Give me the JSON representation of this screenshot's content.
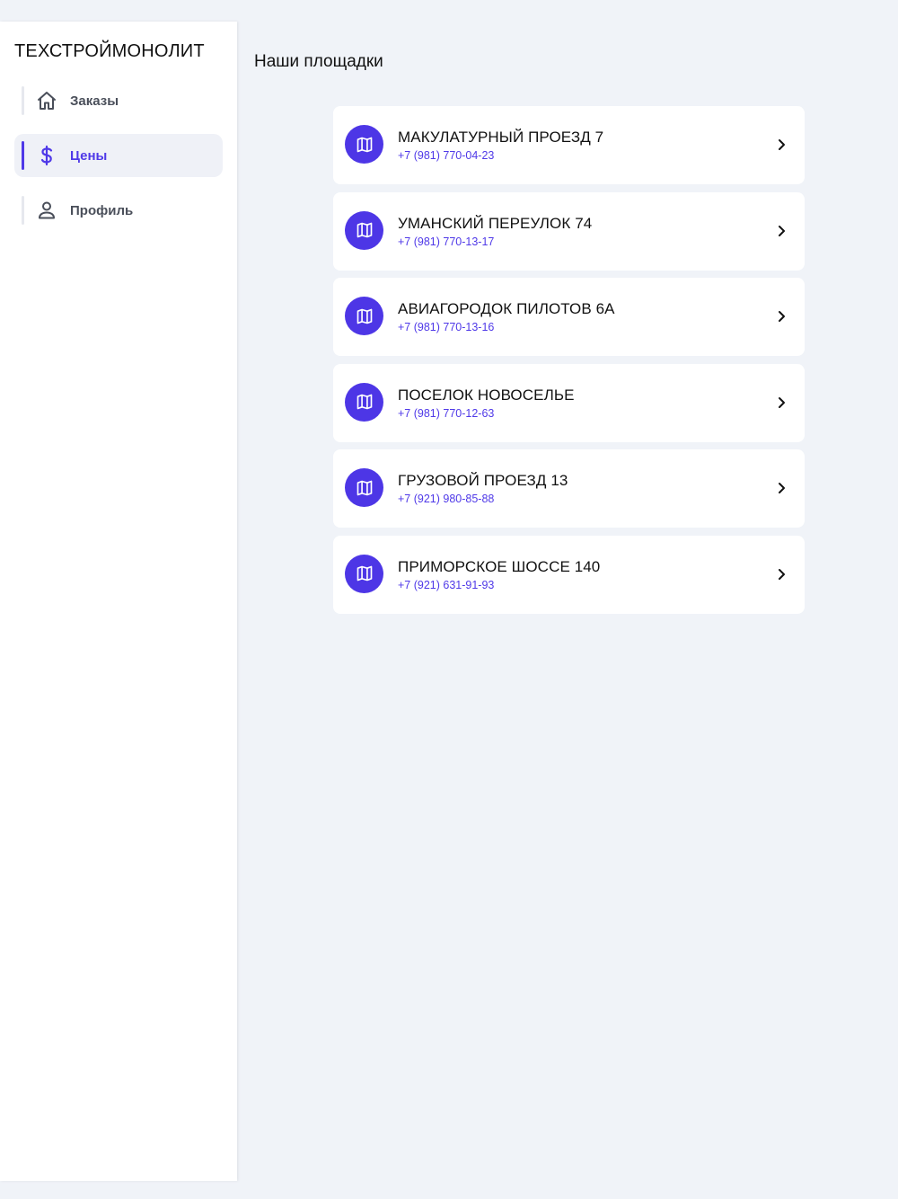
{
  "brand": "ТЕХСТРОЙМОНОЛИТ",
  "nav": [
    {
      "label": "Заказы",
      "icon": "home-icon",
      "active": false
    },
    {
      "label": "Цены",
      "icon": "dollar-icon",
      "active": true
    },
    {
      "label": "Профиль",
      "icon": "user-icon",
      "active": false
    }
  ],
  "main": {
    "title": "Наши площадки"
  },
  "sites": [
    {
      "name": "МАКУЛАТУРНЫЙ ПРОЕЗД 7",
      "phone": "+7 (981) 770-04-23",
      "icon": "map-icon"
    },
    {
      "name": "УМАНСКИЙ ПЕРЕУЛОК 74",
      "phone": "+7 (981) 770-13-17",
      "icon": "map-icon"
    },
    {
      "name": "АВИАГОРОДОК ПИЛОТОВ 6А",
      "phone": "+7 (981) 770-13-16",
      "icon": "map-icon"
    },
    {
      "name": "ПОСЕЛОК НОВОСЕЛЬЕ",
      "phone": "+7 (981) 770-12-63",
      "icon": "map-icon"
    },
    {
      "name": "ГРУЗОВОЙ ПРОЕЗД 13",
      "phone": "+7 (921) 980-85-88",
      "icon": "map-icon"
    },
    {
      "name": "ПРИМОРСКОЕ ШОССЕ 140",
      "phone": "+7 (921) 631-91-93",
      "icon": "map-icon"
    }
  ],
  "colors": {
    "accent": "#4f39e8",
    "background": "#f0f3f8",
    "muted": "#4a4f5a"
  }
}
